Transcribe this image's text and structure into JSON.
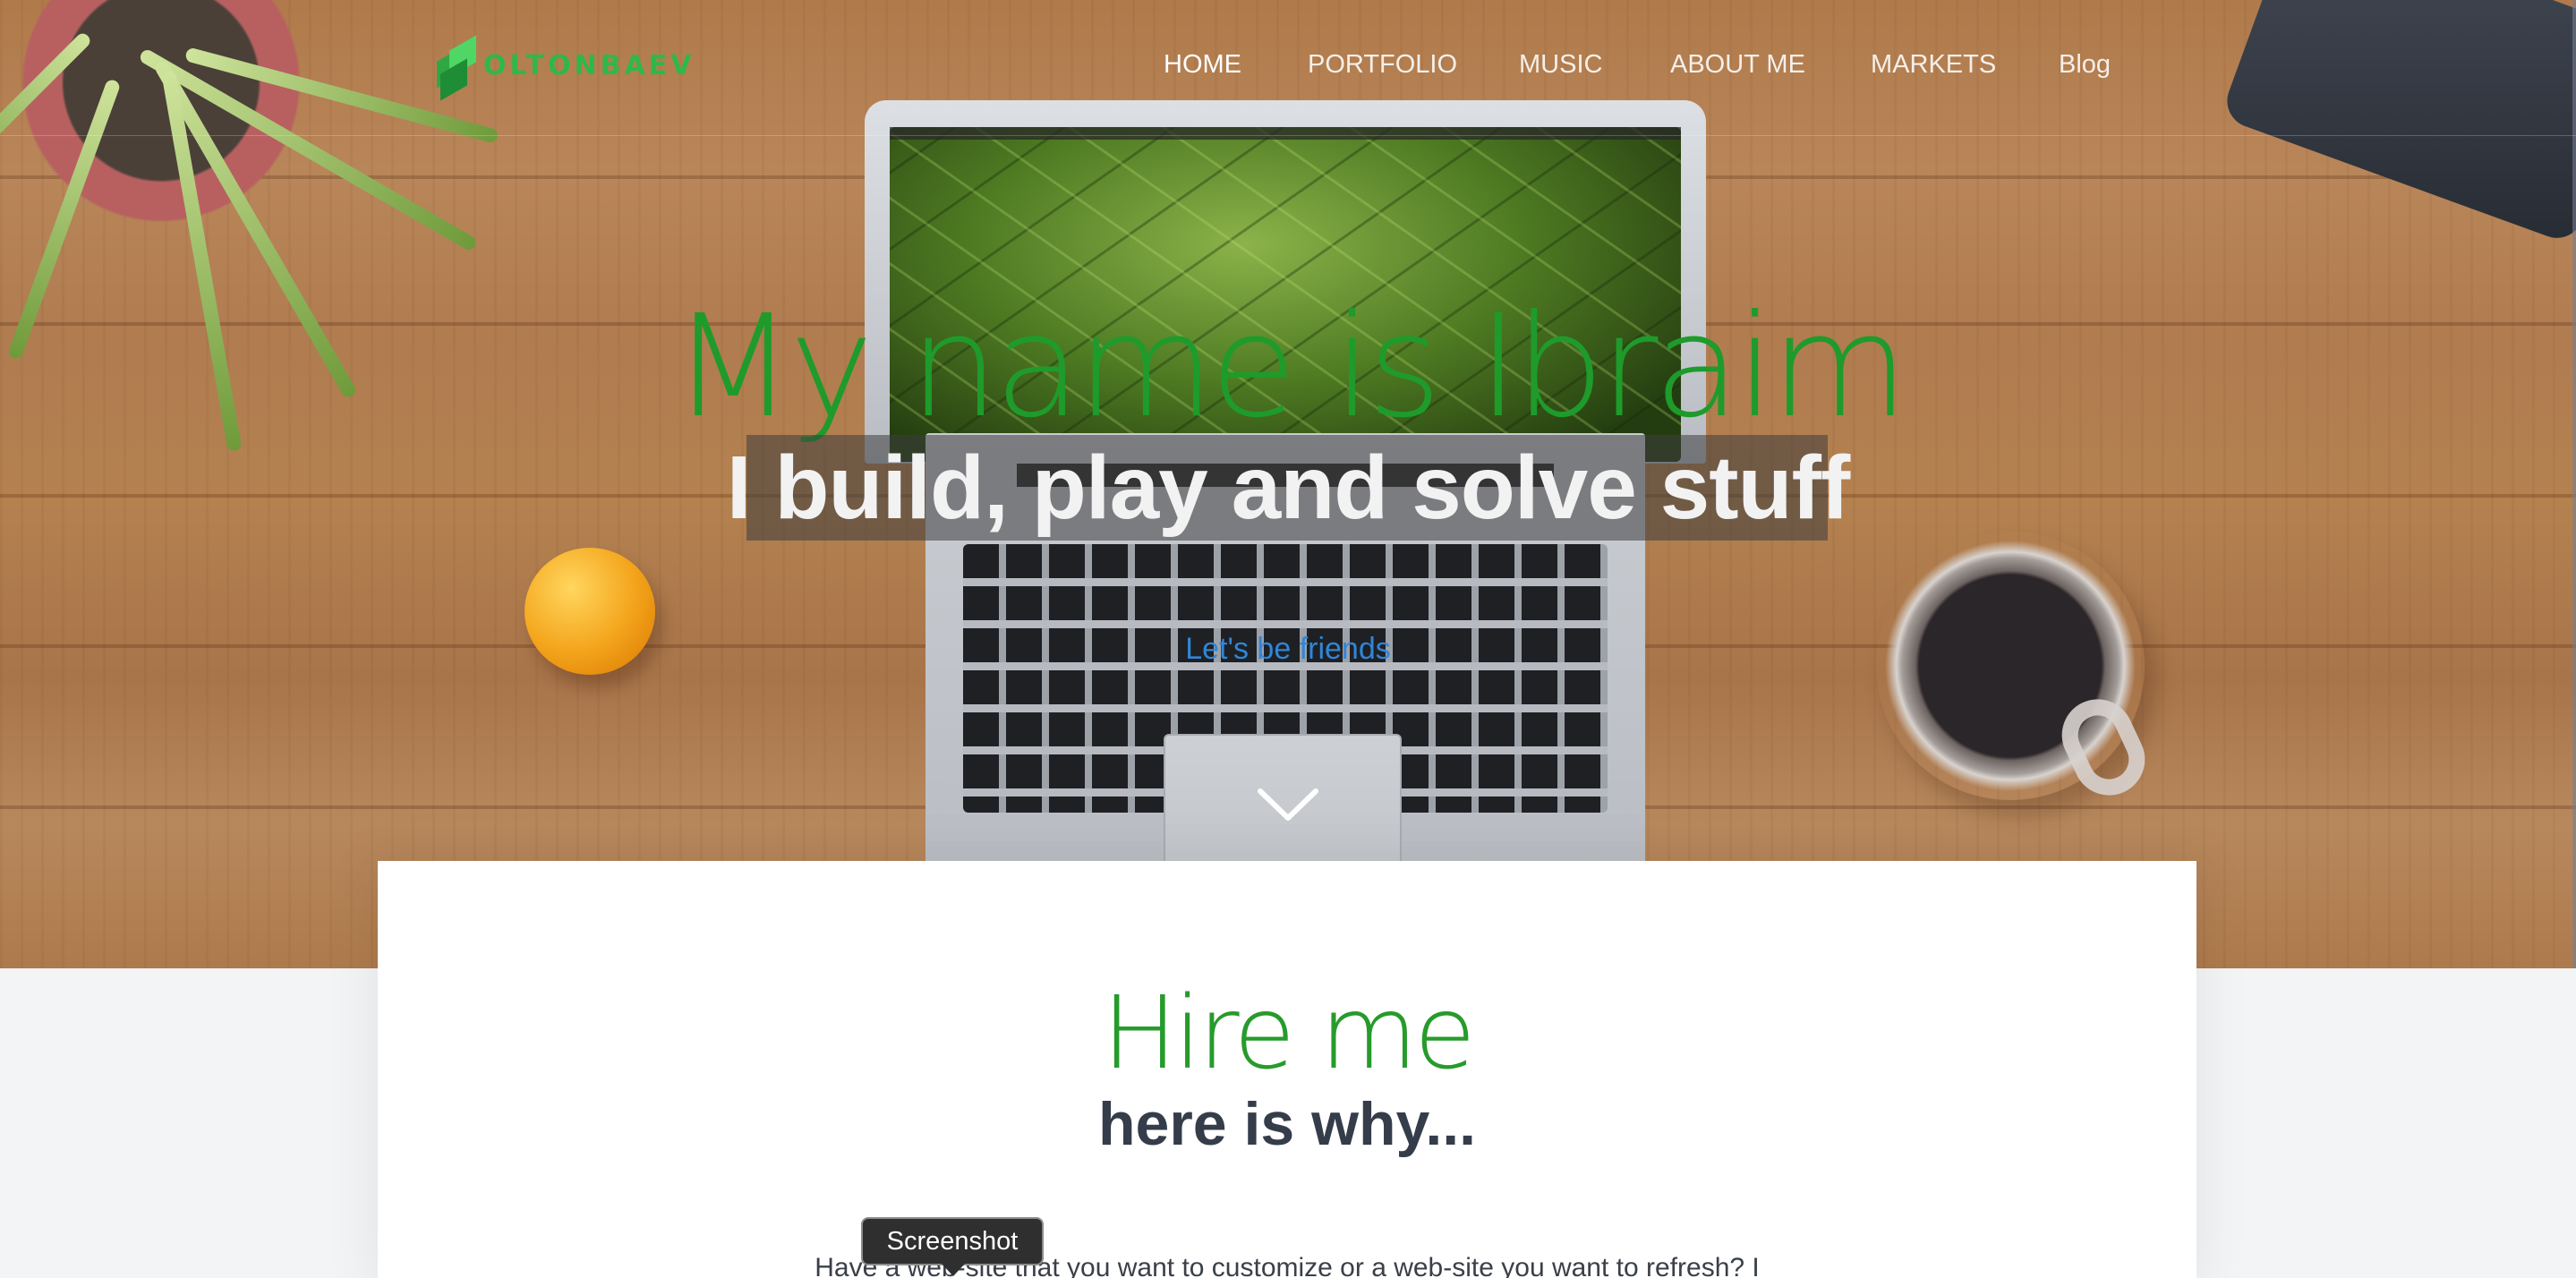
{
  "brand": {
    "logo_text": "OLTONBAEV",
    "accent_color": "#2fb84a"
  },
  "nav": {
    "items": [
      {
        "label": "HOME",
        "active": true
      },
      {
        "label": "PORTFOLIO",
        "active": false
      },
      {
        "label": "MUSIC",
        "active": false
      },
      {
        "label": "ABOUT ME",
        "active": false
      },
      {
        "label": "MARKETS",
        "active": false
      },
      {
        "label": "Blog",
        "active": false
      }
    ]
  },
  "hero": {
    "title": "My name is Ibraim",
    "subtitle": "I build, play and solve stuff",
    "link_label": "Let's be friends",
    "scroll_icon": "chevron-down-icon"
  },
  "hire": {
    "title": "Hire me",
    "subtitle": "here is why...",
    "body": "Have a web-site that you want to customize or a web-site you want to refresh? I"
  },
  "tooltip": {
    "label": "Screenshot"
  }
}
